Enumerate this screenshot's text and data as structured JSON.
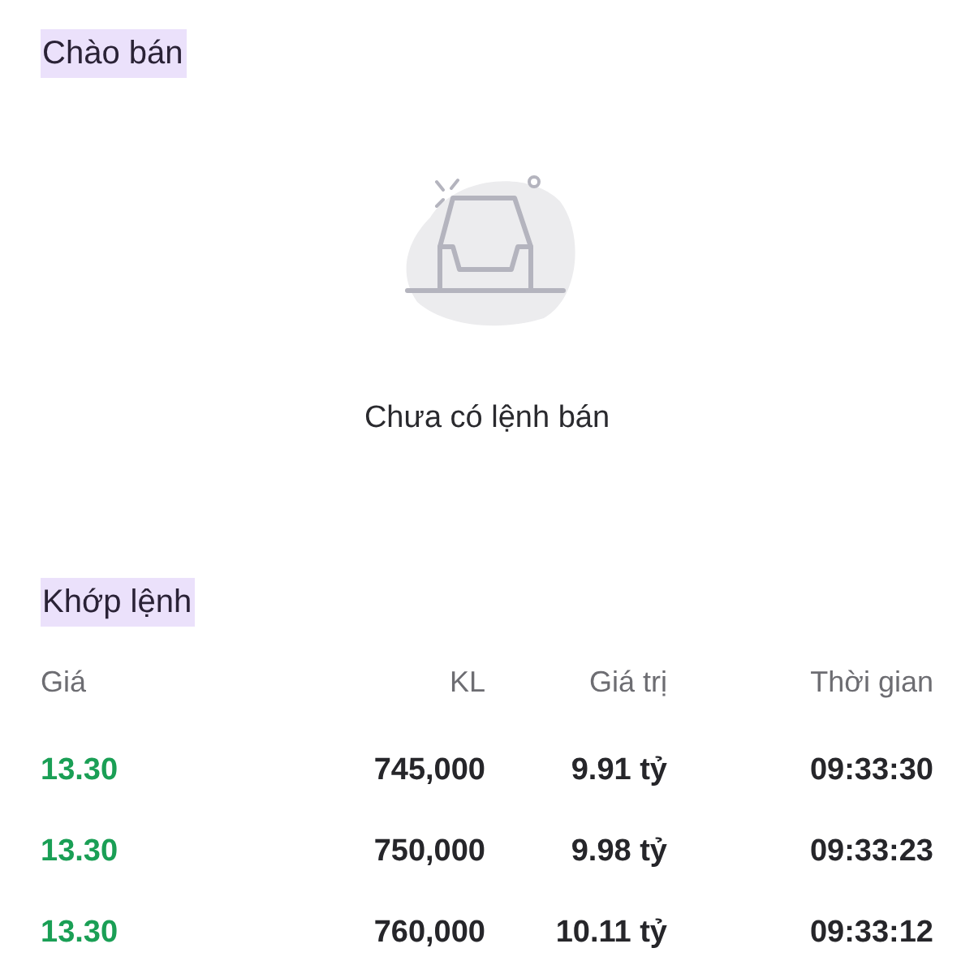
{
  "offers": {
    "title": "Chào bán",
    "empty_message": "Chưa có lệnh bán"
  },
  "matches": {
    "title": "Khớp lệnh",
    "columns": [
      "Giá",
      "KL",
      "Giá trị",
      "Thời gian"
    ],
    "rows": [
      {
        "price": "13.30",
        "volume": "745,000",
        "value": "9.91 tỷ",
        "time": "09:33:30"
      },
      {
        "price": "13.30",
        "volume": "750,000",
        "value": "9.98 tỷ",
        "time": "09:33:23"
      },
      {
        "price": "13.30",
        "volume": "760,000",
        "value": "10.11 tỷ",
        "time": "09:33:12"
      }
    ]
  }
}
